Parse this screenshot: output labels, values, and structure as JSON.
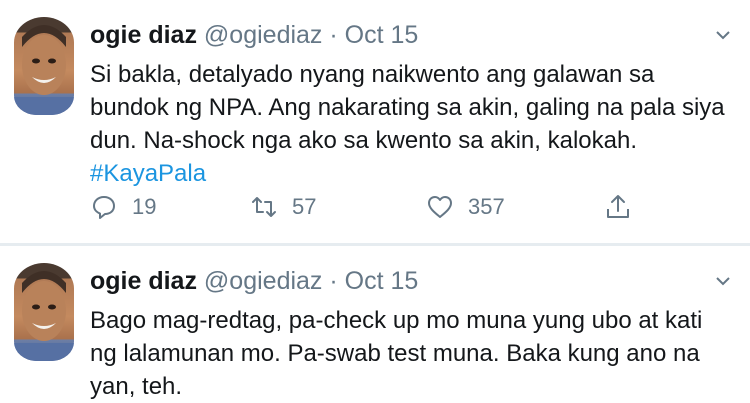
{
  "tweets": [
    {
      "display_name": "ogie diaz",
      "handle": "@ogiediaz",
      "separator": "·",
      "date": "Oct 15",
      "text": "Si bakla, detalyado nyang naikwento ang galawan sa bundok ng NPA. Ang nakarating sa akin, galing na pala siya dun. Na-shock nga ako sa kwento sa akin, kalokah. ",
      "hashtag": "#KayaPala",
      "replies": "19",
      "retweets": "57",
      "likes": "357"
    },
    {
      "display_name": "ogie diaz",
      "handle": "@ogiediaz",
      "separator": "·",
      "date": "Oct 15",
      "text": "Bago mag-redtag, pa-check up mo muna yung ubo at kati ng lalamunan mo. Pa-swab test muna. Baka kung ano na yan, teh."
    }
  ],
  "icons": {
    "reply": "reply-icon",
    "retweet": "retweet-icon",
    "like": "heart-icon",
    "share": "share-icon",
    "menu": "chevron-down-icon"
  },
  "colors": {
    "text": "#14171a",
    "muted": "#657786",
    "link": "#1b95e0",
    "divider": "#e6ecf0"
  }
}
